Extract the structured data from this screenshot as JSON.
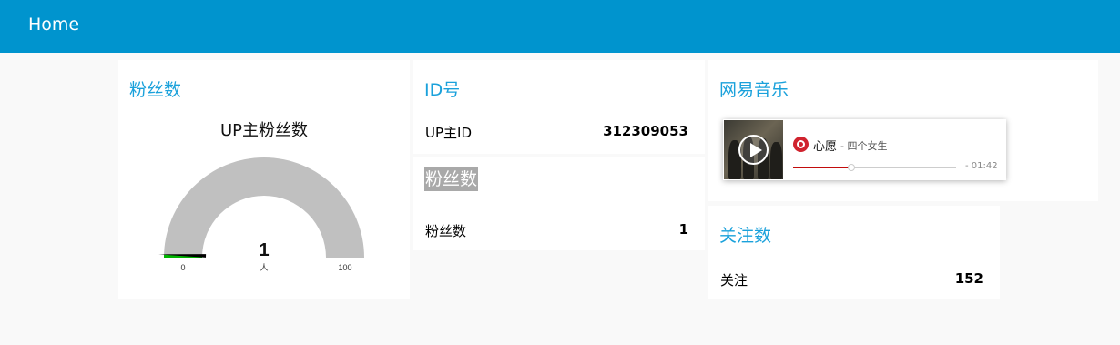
{
  "topbar": {
    "title": "Home"
  },
  "fans_gauge_card": {
    "title": "粉丝数",
    "gauge_title": "UP主粉丝数",
    "value": "1",
    "value_numeric": 1,
    "unit": "人",
    "min_label": "0",
    "max_label": "100",
    "min": 0,
    "max": 100,
    "colors": {
      "track": "#c0c0c0",
      "fill": "#00b500",
      "needle": "#000000"
    }
  },
  "id_card": {
    "title": "ID号",
    "label": "UP主ID",
    "value": "312309053"
  },
  "fans_text_card": {
    "title": "粉丝数",
    "label": "粉丝数",
    "value": "1"
  },
  "music_card": {
    "title": "网易音乐",
    "player": {
      "song": "心愿",
      "artist": "- 四个女生",
      "time": "- 01:42",
      "progress": 0.36,
      "icons": {
        "play": "play-icon",
        "brand": "netease-music-icon"
      }
    }
  },
  "follow_card": {
    "title": "关注数",
    "label": "关注",
    "value": "152"
  },
  "colors": {
    "topbar": "#0094ce",
    "card_title": "#1aa1db",
    "page_bg": "#f9f9f9"
  }
}
